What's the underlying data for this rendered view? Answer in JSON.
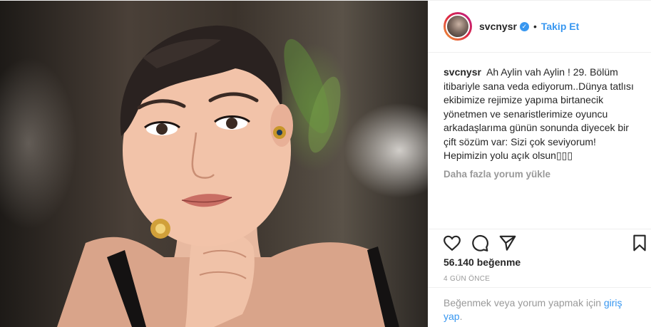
{
  "post": {
    "username": "svcnysr",
    "follow_label": "Takip Et",
    "separator": "•",
    "caption_user": "svcnysr",
    "caption_text": "Ah Aylin vah Aylin ! 29. Bölüm itibariyle sana veda ediyorum..Dünya tatlısı ekibimize rejimize yapıma birtanecik yönetmen ve senaristlerimize oyuncu arkadaşlarıma günün sonunda diyecek bir çift sözüm var: Sizi çok seviyorum! Hepimizin yolu açık olsun▯▯▯",
    "more_comments_label": "Daha fazla yorum yükle",
    "likes_text": "56.140 beğenme",
    "time_ago": "4 GÜN ÖNCE",
    "login_prompt_text": "Beğenmek veya yorum yapmak için ",
    "login_link_text": "giriş yap",
    "login_suffix": "."
  },
  "icons": {
    "verified": "verified-badge-icon",
    "like": "heart-outline-icon",
    "comment": "comment-bubble-icon",
    "share": "share-arrow-icon",
    "save": "bookmark-outline-icon"
  },
  "colors": {
    "accent": "#3897f0",
    "text": "#262626",
    "muted": "#999999",
    "divider": "#efefef"
  }
}
